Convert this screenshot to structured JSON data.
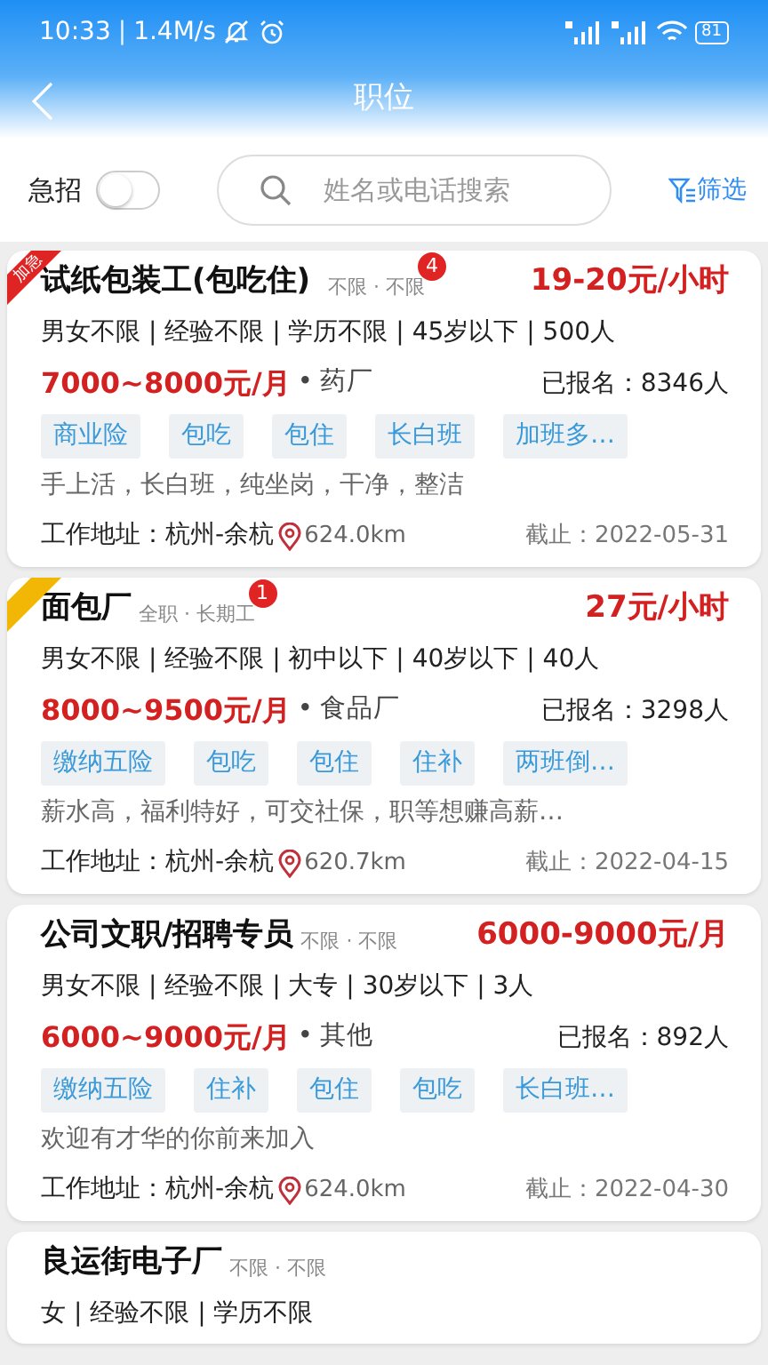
{
  "status_bar": {
    "time": "10:33",
    "divider": "|",
    "speed": "1.4M/s",
    "battery": "81"
  },
  "header": {
    "title": "职位"
  },
  "filters": {
    "urgent_label": "急招",
    "urgent_on": false,
    "search": {
      "placeholder": "姓名或电话搜索"
    },
    "filter_label": "筛选"
  },
  "jobs": [
    {
      "ribbon": {
        "label": "加急",
        "color": "#e02424"
      },
      "title": "试纸包装工(包吃住)",
      "meta": "不限 · 不限",
      "badge": "4",
      "rate": "19-20元/小时",
      "requirements": "男女不限 | 经验不限 | 学历不限 | 45岁以下 | 500人",
      "salary": "7000~8000元/月",
      "bullet": "•",
      "industry": "药厂",
      "signed_up": "已报名：8346人",
      "tags": [
        "商业险",
        "包吃",
        "包住",
        "长白班",
        "加班多…"
      ],
      "description": "手上活，长白班，纯坐岗，干净，整洁",
      "address": "工作地址：杭州-余杭",
      "distance": "624.0km",
      "deadline": "截止：2022-05-31"
    },
    {
      "ribbon": {
        "color": "#f2b705"
      },
      "title": "面包厂",
      "meta": "全职 · 长期工",
      "badge": "1",
      "rate": "27元/小时",
      "requirements": "男女不限 | 经验不限 | 初中以下 | 40岁以下 | 40人",
      "salary": "8000~9500元/月",
      "bullet": "•",
      "industry": "食品厂",
      "signed_up": "已报名：3298人",
      "tags": [
        "缴纳五险",
        "包吃",
        "包住",
        "住补",
        "两班倒…"
      ],
      "description": "薪水高，福利特好，可交社保，职等想赚高薪…",
      "address": "工作地址：杭州-余杭",
      "distance": "620.7km",
      "deadline": "截止：2022-04-15"
    },
    {
      "title": "公司文职/招聘专员",
      "meta": "不限 · 不限",
      "rate": "6000-9000元/月",
      "requirements": "男女不限 | 经验不限 | 大专 | 30岁以下 | 3人",
      "salary": "6000~9000元/月",
      "bullet": "•",
      "industry": "其他",
      "signed_up": "已报名：892人",
      "tags": [
        "缴纳五险",
        "住补",
        "包住",
        "包吃",
        "长白班…"
      ],
      "description": "欢迎有才华的你前来加入",
      "address": "工作地址：杭州-余杭",
      "distance": "624.0km",
      "deadline": "截止：2022-04-30"
    },
    {
      "title": "良运街电子厂",
      "meta": "不限 · 不限",
      "requirements": "女 | 经验不限 | 学历不限"
    }
  ]
}
